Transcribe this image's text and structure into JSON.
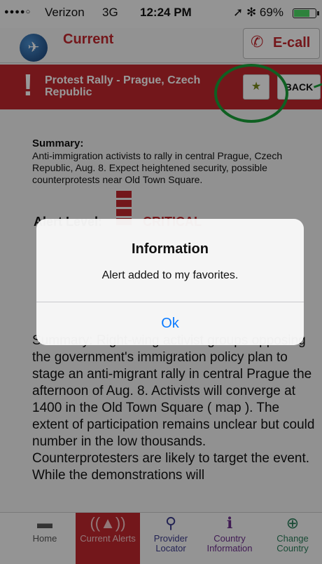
{
  "status": {
    "signal": "●●●●○",
    "carrier": "Verizon",
    "network": "3G",
    "time": "12:24 PM",
    "right": "➚ ✻ 69%"
  },
  "header": {
    "logo_icon": "plane-globe-icon",
    "title": "Current",
    "ecall_icon": "phone-icon",
    "ecall_label": "E-call"
  },
  "alert": {
    "title": "Protest Rally - Prague, Czech Republic",
    "favorite_icon": "star-icon",
    "back_label": "BACK"
  },
  "content": {
    "summary_label": "Summary:",
    "summary_text": "Anti-immigration activists to rally in central Prague, Czech Republic, Aug. 8. Expect heightened security, possible counterprotests near Old Town Square.",
    "alert_level_label": "Alert Level:",
    "alert_level_value": "CRITICAL",
    "body": "Summary: Right-wing activist groups opposing the government's immigration policy plan to stage an anti-migrant rally in central Prague the afternoon of Aug. 8. Activists will converge at 1400 in the Old Town Square ( map ). The extent of participation remains unclear but could number in the low thousands. Counterprotesters are likely to target the event. While the demonstrations will"
  },
  "tabs": [
    {
      "label": "Home",
      "icon": "home-icon",
      "glyph": "▬"
    },
    {
      "label": "Current Alerts",
      "icon": "alarm-icon",
      "glyph": "((▲))"
    },
    {
      "label": "Provider Locator",
      "icon": "search-icon",
      "glyph": "⚲"
    },
    {
      "label": "Country Information",
      "icon": "info-icon",
      "glyph": "ℹ"
    },
    {
      "label": "Change Country",
      "icon": "globe-icon",
      "glyph": "⊕"
    }
  ],
  "dialog": {
    "title": "Information",
    "message": "Alert added to my favorites.",
    "ok_label": "Ok"
  },
  "colors": {
    "brand_red": "#c0272d",
    "annotation_green": "#1aa13a",
    "ios_blue": "#0a7aff"
  }
}
